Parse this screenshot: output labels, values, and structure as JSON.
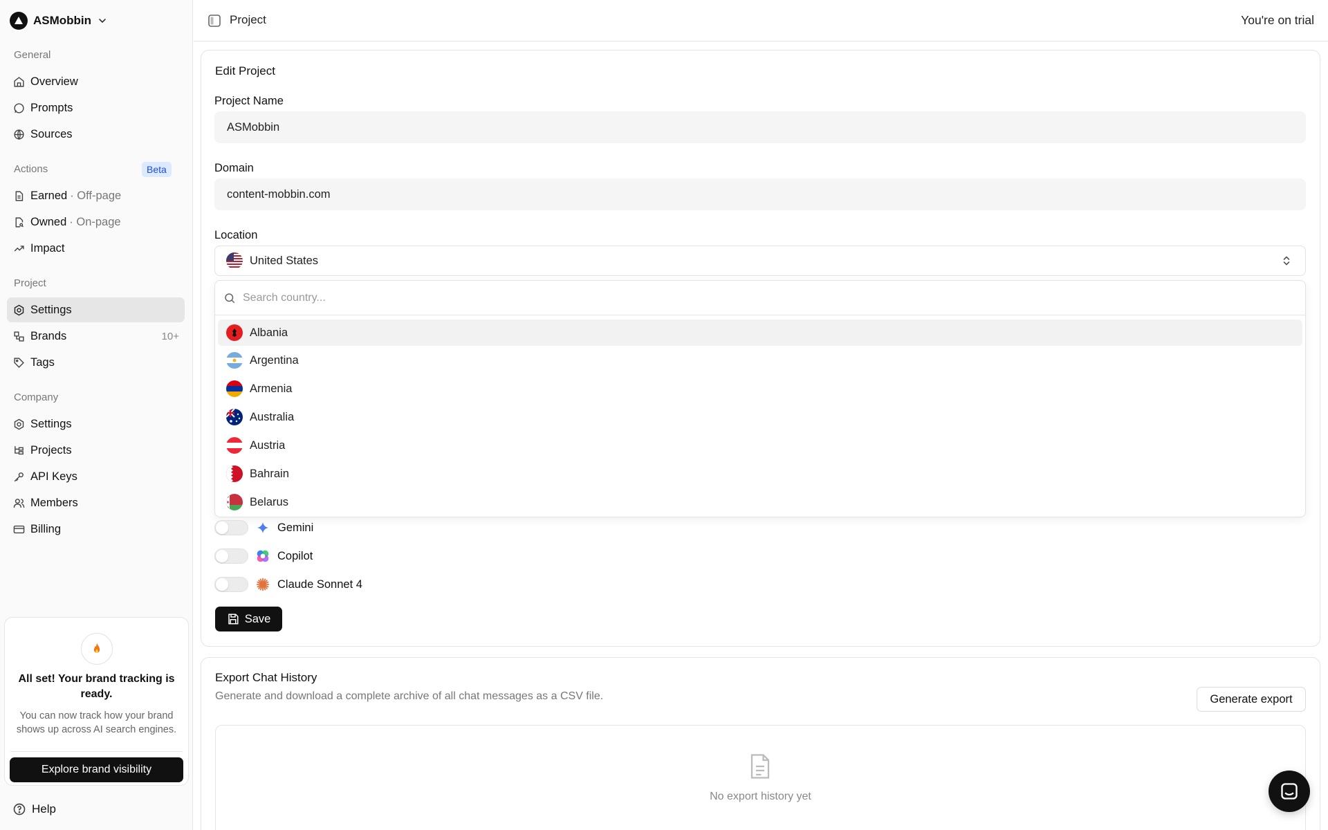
{
  "workspace": {
    "name": "ASMobbin"
  },
  "sidebar": {
    "general_label": "General",
    "general": [
      {
        "label": "Overview"
      },
      {
        "label": "Prompts"
      },
      {
        "label": "Sources"
      }
    ],
    "actions_label": "Actions",
    "actions_badge": "Beta",
    "actions": [
      {
        "label": "Earned",
        "sub": "· Off-page"
      },
      {
        "label": "Owned",
        "sub": "· On-page"
      },
      {
        "label": "Impact"
      }
    ],
    "project_label": "Project",
    "project": [
      {
        "label": "Settings"
      },
      {
        "label": "Brands",
        "count": "10+"
      },
      {
        "label": "Tags"
      }
    ],
    "company_label": "Company",
    "company": [
      {
        "label": "Settings"
      },
      {
        "label": "Projects"
      },
      {
        "label": "API Keys"
      },
      {
        "label": "Members"
      },
      {
        "label": "Billing"
      }
    ],
    "promo": {
      "title": "All set! Your brand tracking is ready.",
      "text": "You can now track how your brand shows up across AI search engines.",
      "button": "Explore brand visibility"
    },
    "help": "Help"
  },
  "topbar": {
    "title": "Project",
    "trial": "You're on trial"
  },
  "edit": {
    "title": "Edit Project",
    "name_label": "Project Name",
    "name_value": "ASMobbin",
    "domain_label": "Domain",
    "domain_value": "content-mobbin.com",
    "location_label": "Location",
    "location_value": "United States",
    "search_placeholder": "Search country...",
    "countries": [
      "Albania",
      "Argentina",
      "Armenia",
      "Australia",
      "Austria",
      "Bahrain",
      "Belarus"
    ],
    "models": [
      "Gemini",
      "Copilot",
      "Claude Sonnet 4"
    ],
    "save": "Save"
  },
  "export": {
    "title": "Export Chat History",
    "description": "Generate and download a complete archive of all chat messages as a CSV file.",
    "button": "Generate export",
    "empty": "No export history yet"
  },
  "colors": {
    "accent": "#111111",
    "active_bg": "#e6e6e6",
    "beta_bg": "#dbeafe",
    "beta_fg": "#1d4ed8"
  }
}
